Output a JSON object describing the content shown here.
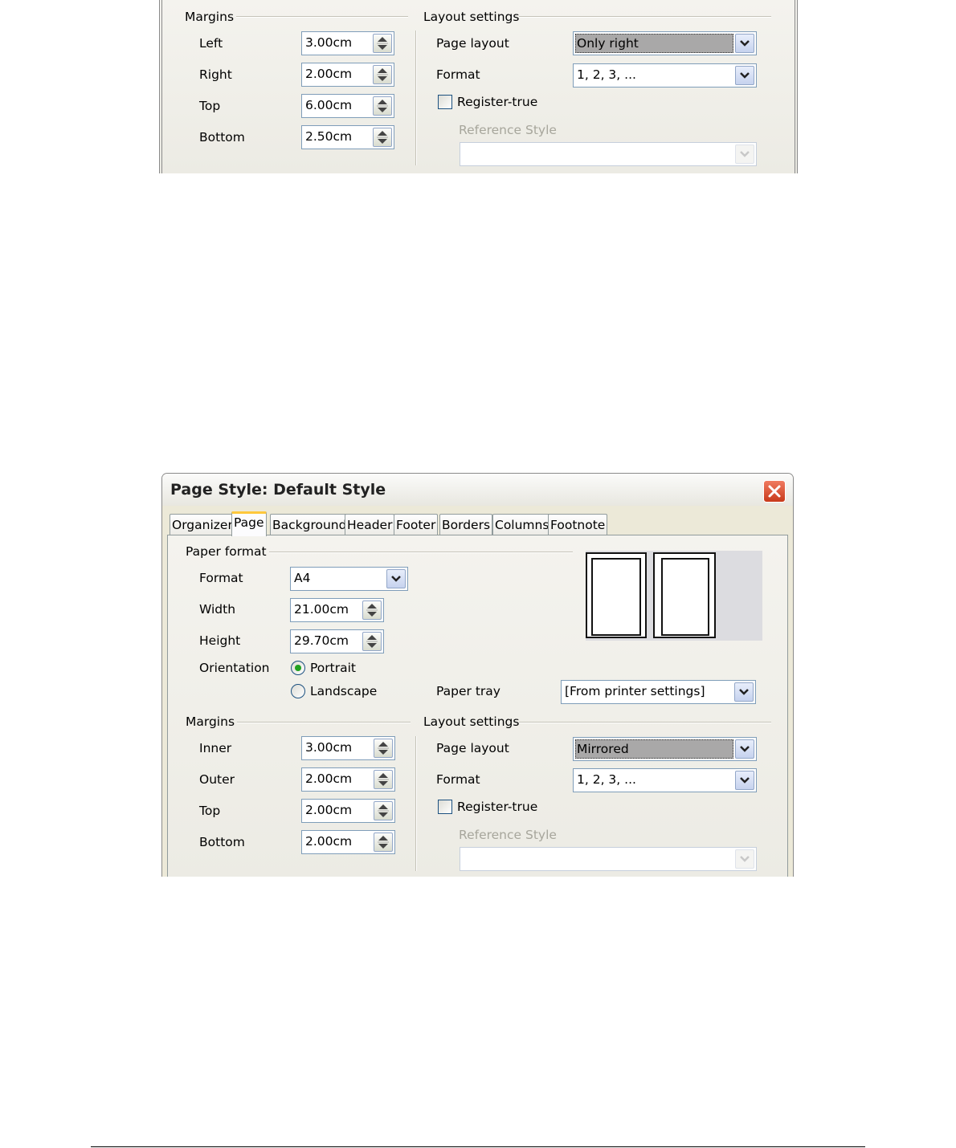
{
  "top_dialog": {
    "margins": {
      "title": "Margins",
      "fields": [
        {
          "label": "Left",
          "value": "3.00cm"
        },
        {
          "label": "Right",
          "value": "2.00cm"
        },
        {
          "label": "Top",
          "value": "6.00cm"
        },
        {
          "label": "Bottom",
          "value": "2.50cm"
        }
      ]
    },
    "layout": {
      "title": "Layout settings",
      "page_layout_label": "Page layout",
      "page_layout_value": "Only right",
      "format_label": "Format",
      "format_value": "1, 2, 3, ...",
      "register_true_label": "Register-true",
      "register_true_checked": false,
      "reference_style_label": "Reference Style",
      "reference_style_value": ""
    }
  },
  "bottom_dialog": {
    "title": "Page Style: Default Style",
    "tabs": [
      "Organizer",
      "Page",
      "Background",
      "Header",
      "Footer",
      "Borders",
      "Columns",
      "Footnote"
    ],
    "active_tab": "Page",
    "paper_format": {
      "title": "Paper format",
      "format_label": "Format",
      "format_value": "A4",
      "width_label": "Width",
      "width_value": "21.00cm",
      "height_label": "Height",
      "height_value": "29.70cm",
      "orientation_label": "Orientation",
      "portrait_label": "Portrait",
      "landscape_label": "Landscape",
      "orientation_selected": "Portrait",
      "paper_tray_label": "Paper tray",
      "paper_tray_value": "[From printer settings]"
    },
    "margins": {
      "title": "Margins",
      "fields": [
        {
          "label": "Inner",
          "value": "3.00cm"
        },
        {
          "label": "Outer",
          "value": "2.00cm"
        },
        {
          "label": "Top",
          "value": "2.00cm"
        },
        {
          "label": "Bottom",
          "value": "2.00cm"
        }
      ]
    },
    "layout": {
      "title": "Layout settings",
      "page_layout_label": "Page layout",
      "page_layout_value": "Mirrored",
      "format_label": "Format",
      "format_value": "1, 2, 3, ...",
      "register_true_label": "Register-true",
      "register_true_checked": false,
      "reference_style_label": "Reference Style",
      "reference_style_value": ""
    }
  },
  "colors": {
    "title_bar": "#ece9d8",
    "close_button": "#e04b2a",
    "active_tab_highlight": "#ffc83c",
    "selected_combo": "#a9a8a8",
    "preview_panel": "#dcdce0"
  },
  "icons": [
    "spin-up-down-icon",
    "chevron-down-icon",
    "close-icon",
    "checkbox-icon",
    "radio-icon"
  ]
}
